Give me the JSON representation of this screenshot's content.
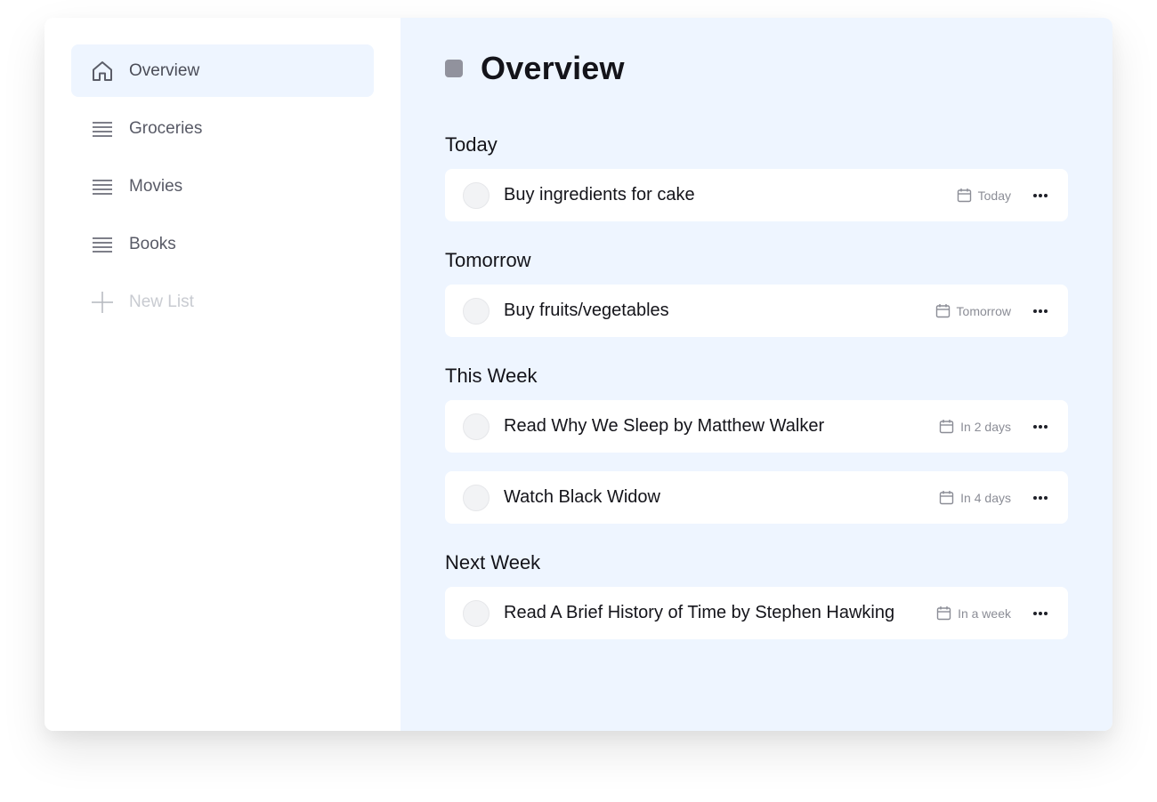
{
  "sidebar": {
    "items": [
      {
        "label": "Overview",
        "icon": "home-icon",
        "active": true
      },
      {
        "label": "Groceries",
        "icon": "list-icon"
      },
      {
        "label": "Movies",
        "icon": "list-icon"
      },
      {
        "label": "Books",
        "icon": "list-icon"
      }
    ],
    "new_list_label": "New List"
  },
  "main": {
    "title": "Overview",
    "sections": [
      {
        "title": "Today",
        "tasks": [
          {
            "title": "Buy ingredients for cake",
            "due": "Today"
          }
        ]
      },
      {
        "title": "Tomorrow",
        "tasks": [
          {
            "title": "Buy fruits/vegetables",
            "due": "Tomorrow"
          }
        ]
      },
      {
        "title": "This Week",
        "tasks": [
          {
            "title": "Read Why We Sleep by Matthew Walker",
            "due": "In 2 days"
          },
          {
            "title": "Watch Black Widow",
            "due": "In 4 days"
          }
        ]
      },
      {
        "title": "Next Week",
        "tasks": [
          {
            "title": "Read A Brief History of Time by Stephen Hawking",
            "due": "In a week"
          }
        ]
      }
    ]
  },
  "colors": {
    "accent_bg": "#eef5ff",
    "title_square": "#91929d",
    "text_dark": "#14141a",
    "text_muted": "#8b8d96"
  }
}
